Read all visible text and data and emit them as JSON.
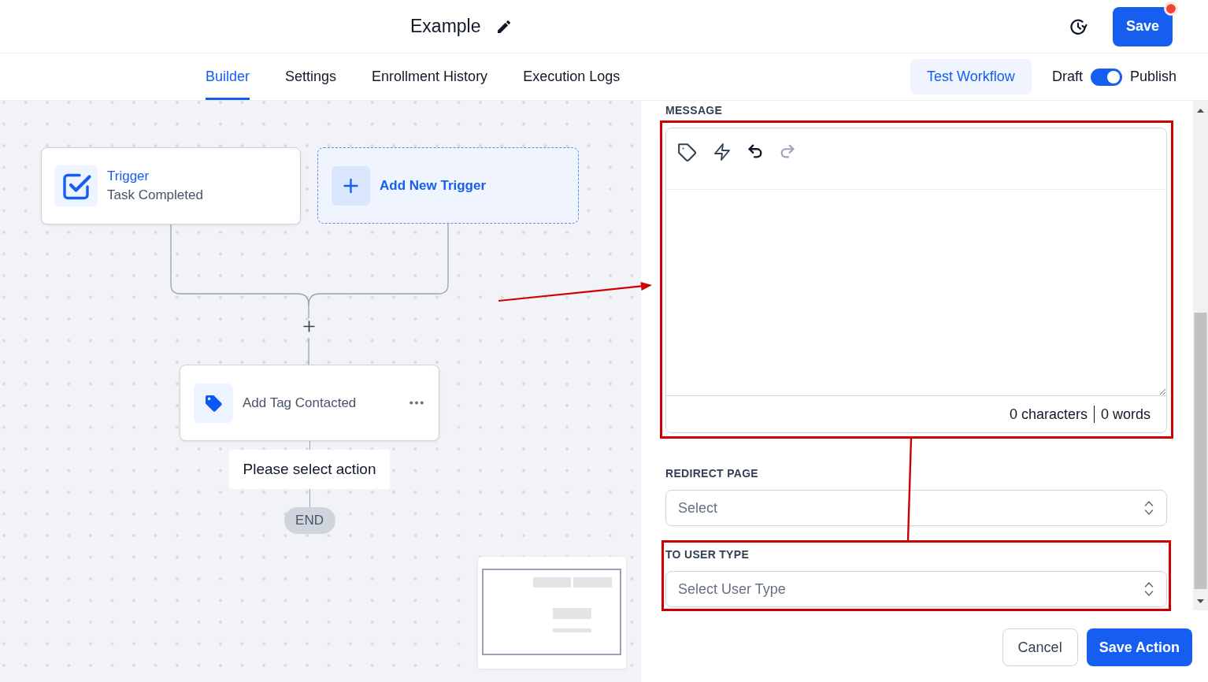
{
  "header": {
    "title": "Example",
    "save_button": {
      "label": "Save",
      "unsaved": true
    }
  },
  "tabs": [
    {
      "label": "Builder",
      "selected": true
    },
    {
      "label": "Settings",
      "selected": false
    },
    {
      "label": "Enrollment History",
      "selected": false
    },
    {
      "label": "Execution Logs",
      "selected": false
    }
  ],
  "toolbar": {
    "test_button": "Test Workflow",
    "publish_switch": {
      "off_label": "Draft",
      "on_label": "Publish",
      "on": true
    }
  },
  "canvas": {
    "triggers": [
      {
        "title": "Trigger",
        "subtitle": "Task Completed"
      }
    ],
    "add_trigger": "Add New Trigger",
    "actions": [
      {
        "label": "Add Tag Contacted"
      }
    ],
    "prompt": "Please select action",
    "end": "END"
  },
  "panel": {
    "message": {
      "label": "MESSAGE",
      "highlighted": true,
      "tools": [
        {
          "kind": "tag",
          "disabled": false
        },
        {
          "kind": "bolt",
          "disabled": false
        },
        {
          "kind": "undo",
          "disabled": false
        },
        {
          "kind": "redo",
          "disabled": true
        }
      ],
      "char_count": "0 characters",
      "word_count": "0 words"
    },
    "fields": [
      {
        "label": "REDIRECT PAGE",
        "placeholder": "Select",
        "highlighted": false
      },
      {
        "label": "TO USER TYPE",
        "placeholder": "Select User Type",
        "highlighted": true
      }
    ],
    "buttons": [
      {
        "label": "Cancel",
        "kind": "secondary"
      },
      {
        "label": "Save Action",
        "kind": "primary"
      }
    ]
  }
}
